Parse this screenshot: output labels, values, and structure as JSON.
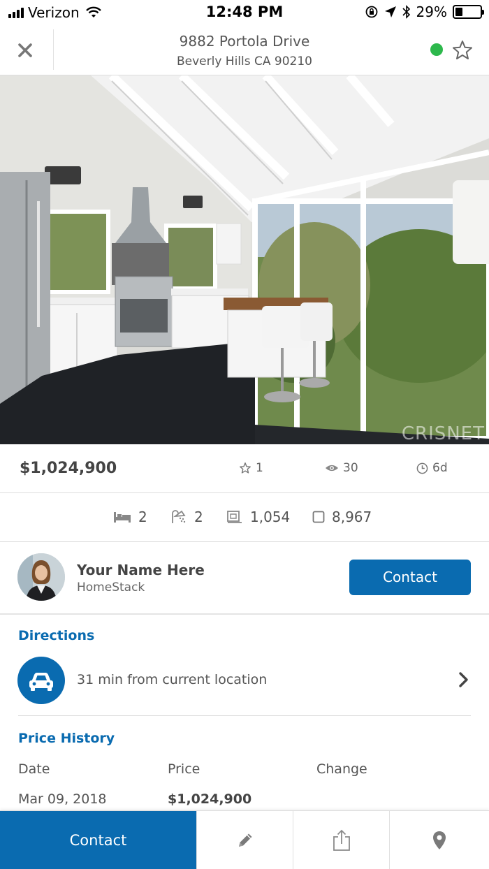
{
  "status_bar": {
    "carrier": "Verizon",
    "time": "12:48 PM",
    "battery": "29%"
  },
  "header": {
    "title": "9882 Portola Drive",
    "subtitle": "Beverly Hills CA 90210",
    "status_color": "#2db84c",
    "close_icon": "close-icon",
    "favorite_icon": "star-icon"
  },
  "hero": {
    "watermark": "CRISNET"
  },
  "listing": {
    "price": "$1,024,900",
    "favorites": "1",
    "views": "30",
    "age": "6d"
  },
  "features": {
    "beds": "2",
    "baths": "2",
    "sqft": "1,054",
    "lot": "8,967"
  },
  "agent": {
    "name": "Your Name Here",
    "company": "HomeStack",
    "contact_label": "Contact"
  },
  "directions": {
    "title": "Directions",
    "text": "31 min from current location"
  },
  "price_history": {
    "title": "Price History",
    "headers": [
      "Date",
      "Price",
      "Change"
    ],
    "rows": [
      {
        "date": "Mar 09, 2018",
        "price": "$1,024,900",
        "change": ""
      }
    ]
  },
  "bottom_bar": {
    "contact_label": "Contact",
    "icons": [
      "pencil-icon",
      "share-icon",
      "map-pin-icon"
    ]
  },
  "colors": {
    "accent": "#0a6bb0",
    "text": "#555555"
  }
}
